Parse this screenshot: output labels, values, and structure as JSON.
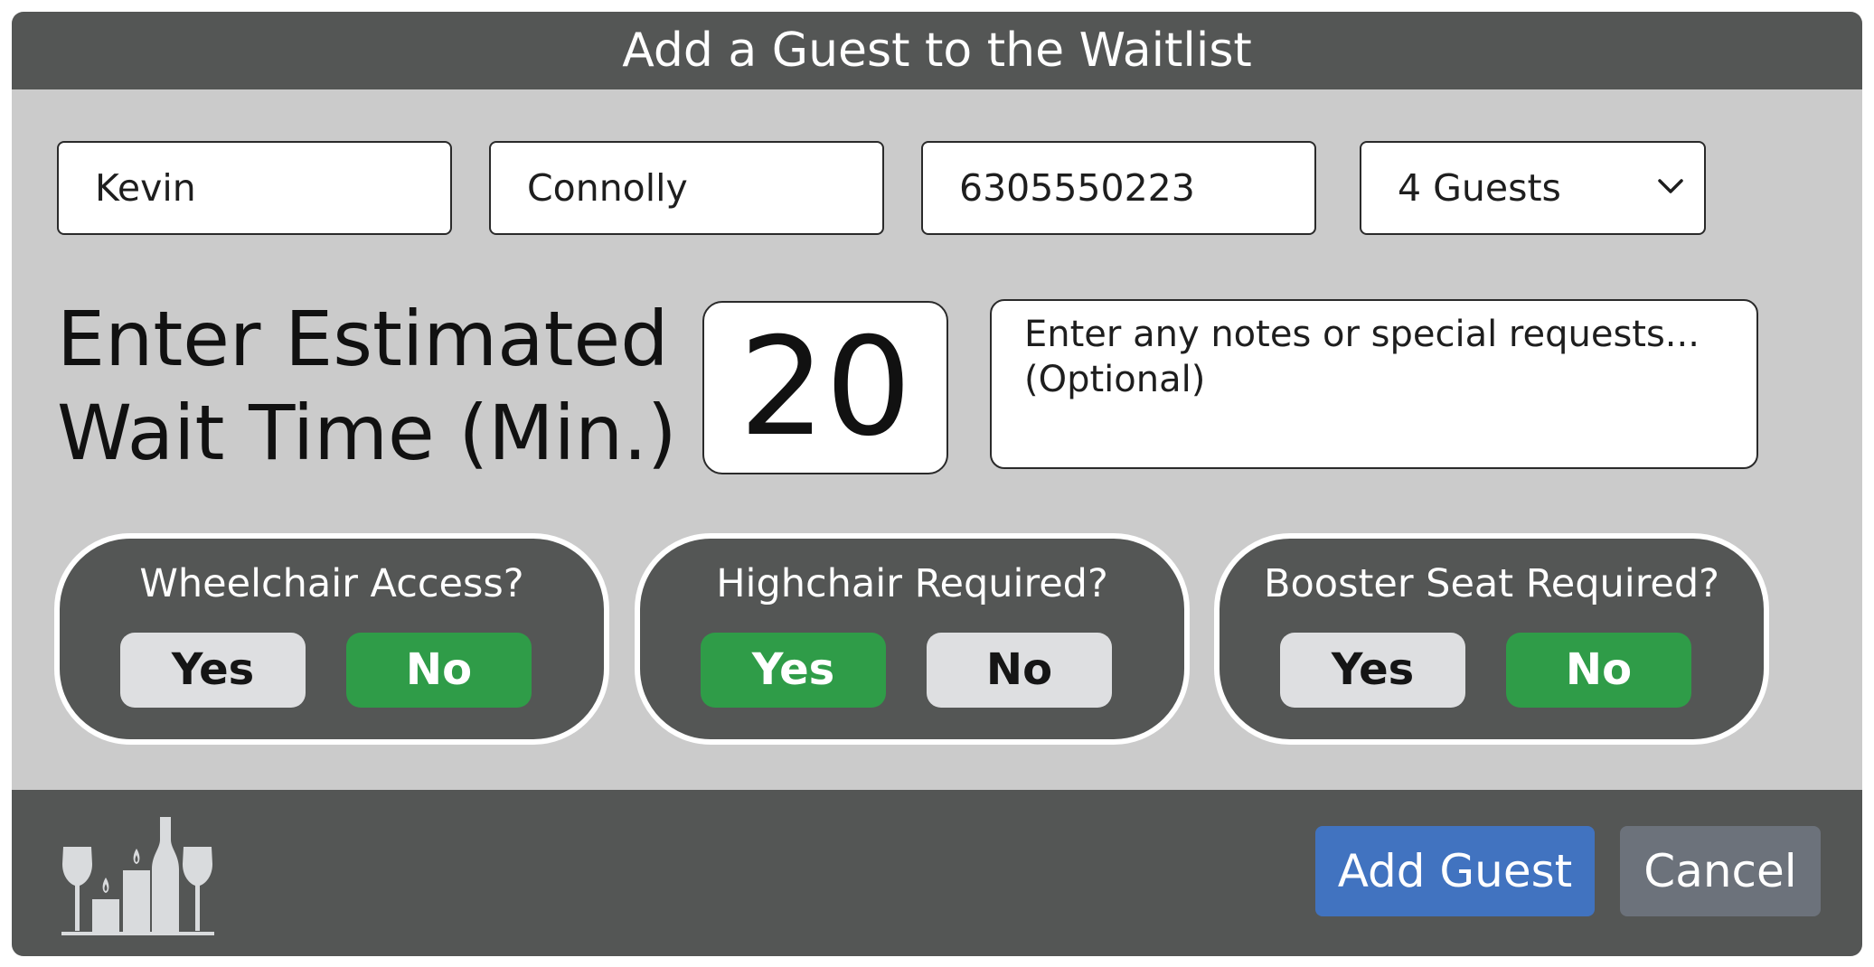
{
  "title": "Add a Guest to the Waitlist",
  "form": {
    "first_name": "Kevin",
    "last_name": "Connolly",
    "phone": "6305550223",
    "party_size": "4 Guests",
    "wait_label_line1": "Enter Estimated",
    "wait_label_line2": "Wait Time (Min.)",
    "wait_minutes": "20",
    "notes_placeholder_line1": "Enter any notes or special requests...",
    "notes_placeholder_line2": "(Optional)"
  },
  "toggles": [
    {
      "label": "Wheelchair Access?",
      "yes": "Yes",
      "no": "No",
      "selected": "No"
    },
    {
      "label": "Highchair Required?",
      "yes": "Yes",
      "no": "No",
      "selected": "Yes"
    },
    {
      "label": "Booster Seat Required?",
      "yes": "Yes",
      "no": "No",
      "selected": "No"
    }
  ],
  "footer": {
    "logo_icon": "restaurant-candles-wine-icon",
    "add_label": "Add Guest",
    "cancel_label": "Cancel"
  },
  "colors": {
    "chrome": "#545655",
    "panel": "#cbcbcb",
    "selected_green": "#2f9c48",
    "unselected": "#dedfe1",
    "primary_blue": "#4173c0",
    "cancel_gray": "#6c727b"
  }
}
